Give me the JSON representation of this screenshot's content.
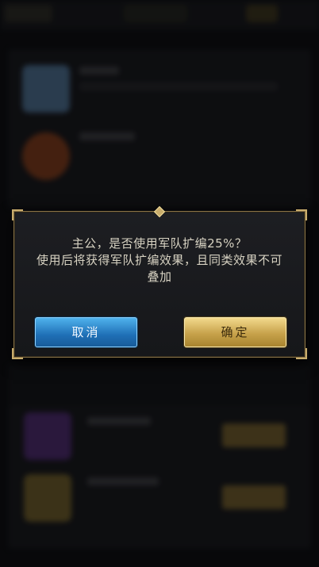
{
  "dialog": {
    "message": "主公，是否使用军队扩编25%？\n使用后将获得军队扩编效果，且同类效果不可叠加",
    "cancel_label": "取消",
    "confirm_label": "确定"
  },
  "colors": {
    "dialog_border": "#8a7448",
    "cancel_button": "#1f6fb6",
    "confirm_button": "#c7a24b"
  }
}
